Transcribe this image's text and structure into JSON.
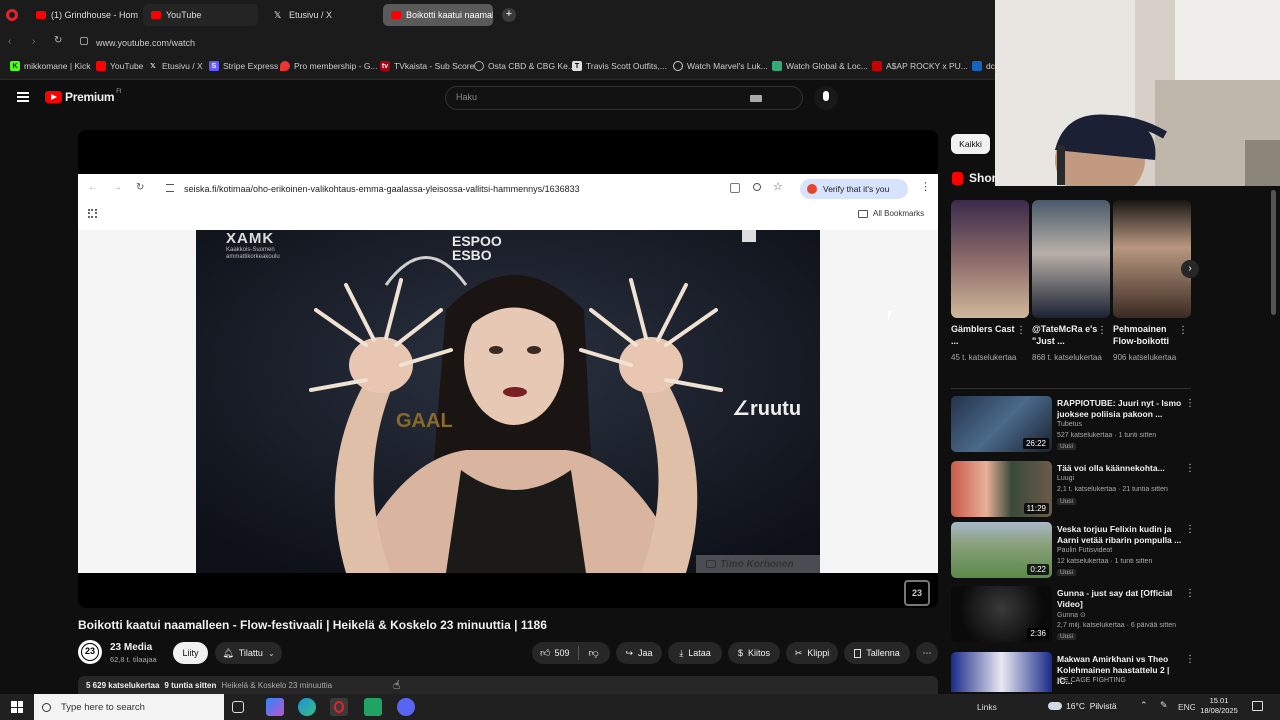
{
  "tabs": [
    {
      "label": "(1) Grindhouse - Home of",
      "active": false
    },
    {
      "label": "YouTube",
      "active": false
    },
    {
      "label": "Etusivu / X",
      "active": false
    },
    {
      "label": "Boikotti kaatui naamallee",
      "active": true
    }
  ],
  "address": "www.youtube.com/watch",
  "bookmarks": [
    "mikkomane | Kick",
    "YouTube",
    "Etusivu / X",
    "Stripe Express",
    "Pro membership - G...",
    "TVkaista - Sub Score",
    "Osta CBD & CBG Ke...",
    "Travis Scott Outfits,...",
    "Watch Marvel's Luk...",
    "Watch Global & Loc...",
    "A$AP ROCKY x PU...",
    "dc"
  ],
  "youtube": {
    "logo_text": "Premium",
    "logo_sup": "FI",
    "search_placeholder": "Haku"
  },
  "inner_browser": {
    "url": "seiska.fi/kotimaa/oho-erikoinen-valikohtaus-emma-gaalassa-yleisossa-vallitsi-hammennys/1636833",
    "verify_label": "Verify that it's you",
    "all_bookmarks": "All Bookmarks"
  },
  "photo": {
    "banner_top_left": "XAMK",
    "banner_sub": "Kaakkois-Suomen ammattikorkeakoulu",
    "banner_top_center": "ESPOO",
    "banner_top_center2": "ESBO",
    "banner_right": "ruutu",
    "banner_left_mid": "GAAL",
    "credit": "Timo Korhonen"
  },
  "channel_badge": "23",
  "video": {
    "title": "Boikotti kaatui naamalleen - Flow-festivaali | Heikelä & Koskelo 23 minuuttia | 1186",
    "channel_name": "23 Media",
    "subscribers": "62,8 t. tilaajaa",
    "join_label": "Liity",
    "subscribed_label": "Tilattu",
    "likes": "509",
    "share_label": "Jaa",
    "download_label": "Lataa",
    "thanks_label": "Kiitos",
    "clip_label": "Klippi",
    "save_label": "Tallenna",
    "meta_views": "5 629 katselukertaa",
    "meta_time": "9 tuntia sitten",
    "meta_series": "Heikelä & Koskelo 23 minuuttia"
  },
  "sidebar": {
    "chip_all": "Kaikki",
    "shorts_label": "Shor",
    "shorts": [
      {
        "title": "Gämblers Cast ...",
        "views": "45 t. katselukertaa"
      },
      {
        "title": "@TateMcRa e's \"Just ...",
        "views": "868 t. katselukertaa"
      },
      {
        "title": "Pehmoainen Flow-boikotti",
        "views": "906 katselukertaa"
      }
    ],
    "videos": [
      {
        "title": "RAPPIOTUBE: Juuri nyt - Ismo juoksee poliisia pakoon ...",
        "channel": "Tubetus",
        "views": "527 katselukertaa · 1 tunti sitten",
        "badge": "Uusi",
        "duration": "26:22"
      },
      {
        "title": "Tää voi olla käännekohta...",
        "channel": "Luugi",
        "views": "2,1 t. katselukertaa · 21 tuntia sitten",
        "badge": "Uusi",
        "duration": "11:29"
      },
      {
        "title": "Veska torjuu Felixin kudin ja Aarni vetää ribarin pompulla ...",
        "channel": "Paulin Futisvideot",
        "views": "12 katselukertaa · 1 tunti sitten",
        "badge": "Uusi",
        "duration": "0:22"
      },
      {
        "title": "Gunna - just say dat [Official Video]",
        "channel": "Gunna ⊙",
        "views": "2,7 milj. katselukertaa · 6 päivää sitten",
        "badge": "Uusi",
        "duration": "2:36"
      },
      {
        "title": "Makwan Amirkhani vs Theo Kolehmainen haastattelu 2 | IC...",
        "channel": "ICE CAGE FIGHTING",
        "views": "",
        "badge": "",
        "duration": ""
      }
    ]
  },
  "taskbar": {
    "search_placeholder": "Type here to search",
    "links_label": "Links",
    "weather": "16°C  Pilvistä",
    "lang": "ENG",
    "time": "15.01",
    "date": "18/08/2025"
  },
  "colors": {
    "youtube_red": "#ff0000",
    "bg": "#0f0f0f",
    "chip": "#272727",
    "verify_bg": "#d7e3fc"
  }
}
